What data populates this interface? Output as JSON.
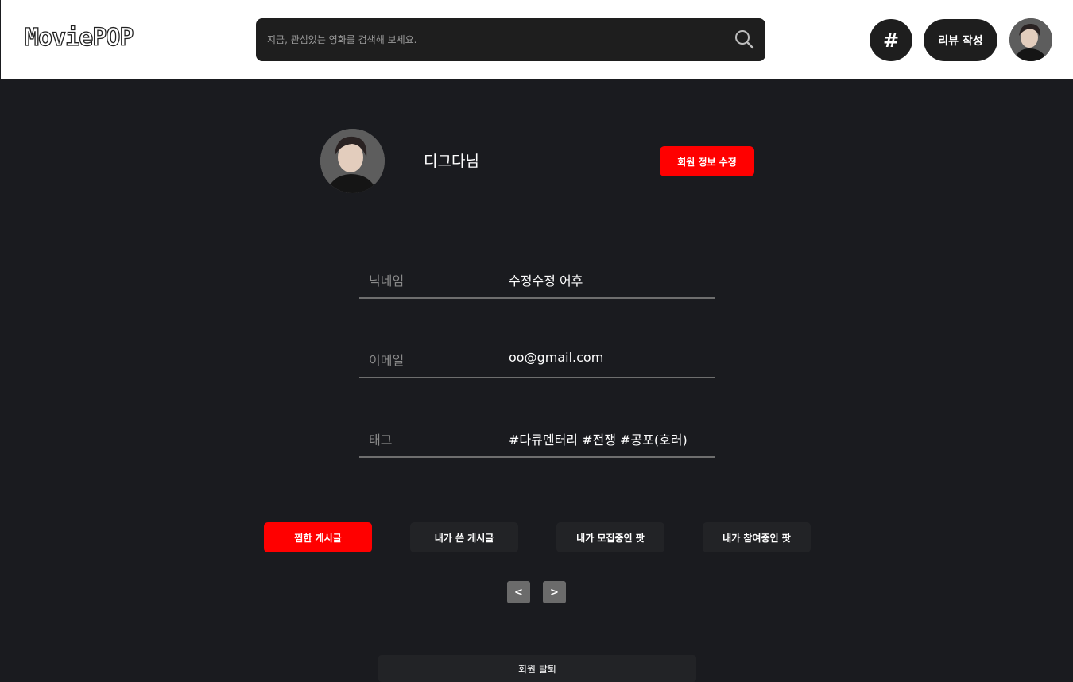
{
  "header": {
    "logo": "MoviePOP",
    "search": {
      "placeholder": "지금, 관심있는 영화를 검색해 보세요.",
      "value": ""
    },
    "hash_label": "#",
    "review_label": "리뷰 작성"
  },
  "profile": {
    "username": "디그다님",
    "edit_label": "회원 정보 수정"
  },
  "fields": [
    {
      "label": "닉네임",
      "value": "수정수정 어후"
    },
    {
      "label": "이메일",
      "value": "oo@gmail.com"
    },
    {
      "label": "태그",
      "value": "#다큐멘터리 #전쟁 #공포(호러)"
    }
  ],
  "tabs": [
    {
      "label": "찜한 게시글",
      "active": true
    },
    {
      "label": "내가 쓴 게시글",
      "active": false
    },
    {
      "label": "내가 모집중인 팟",
      "active": false
    },
    {
      "label": "내가 참여중인 팟",
      "active": false
    }
  ],
  "pagination": {
    "prev": "<",
    "next": ">"
  },
  "withdraw_label": "회원 탈퇴",
  "colors": {
    "accent": "#ff0000",
    "background": "#1a1b1f",
    "header_bg": "#ffffff",
    "button_bg": "#1e1e1e"
  }
}
